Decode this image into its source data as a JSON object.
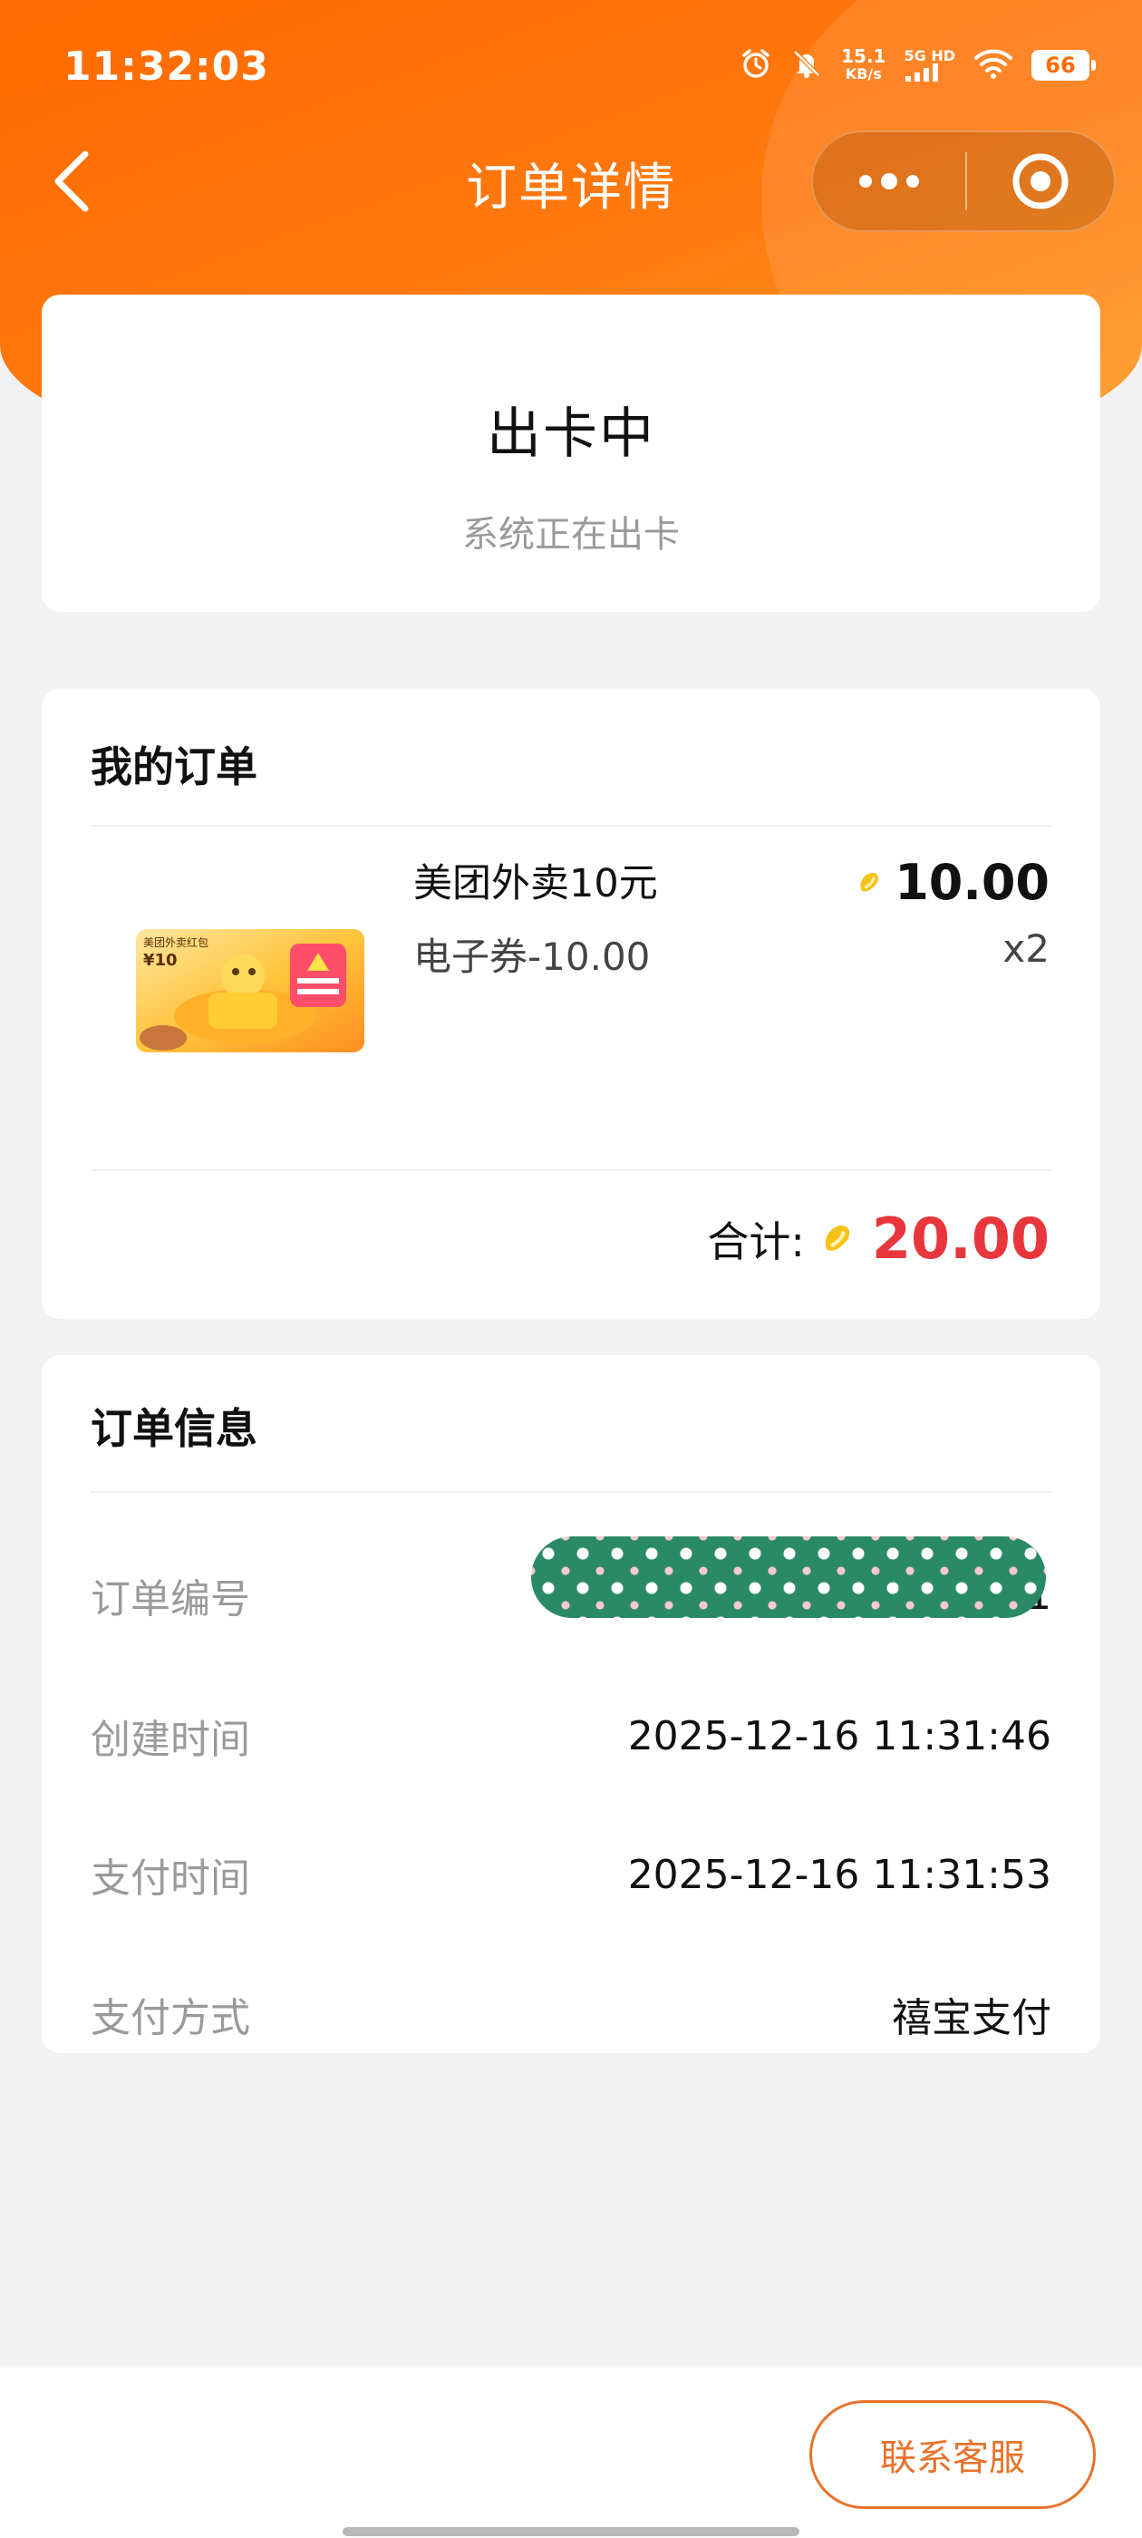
{
  "status_bar": {
    "time": "11:32:03",
    "net_speed_value": "15.1",
    "net_speed_unit": "KB/s",
    "network": "5G HD",
    "battery": "66"
  },
  "nav": {
    "title": "订单详情"
  },
  "order_status": {
    "title": "出卡中",
    "description": "系统正在出卡"
  },
  "my_order": {
    "section_title": "我的订单",
    "product": {
      "name": "美团外卖10元",
      "spec": "电子券-10.00",
      "price": "10.00",
      "quantity": "x2",
      "thumb_label": "美团外卖红包",
      "thumb_amount": "¥10"
    },
    "total_label": "合计:",
    "total_value": "20.00"
  },
  "order_info": {
    "section_title": "订单信息",
    "rows": [
      {
        "label": "订单编号",
        "value": "1"
      },
      {
        "label": "创建时间",
        "value": "2025-12-16 11:31:46"
      },
      {
        "label": "支付时间",
        "value": "2025-12-16 11:31:53"
      },
      {
        "label": "支付方式",
        "value": "禧宝支付"
      }
    ]
  },
  "footer": {
    "contact_label": "联系客服"
  },
  "colors": {
    "brand_orange": "#ff6a00",
    "price_red": "#e8363c",
    "contact_orange": "#e8722a"
  },
  "icons": {
    "back": "chevron-left-icon",
    "more": "more-dots-icon",
    "close": "target-close-icon",
    "coin": "coin-icon"
  }
}
